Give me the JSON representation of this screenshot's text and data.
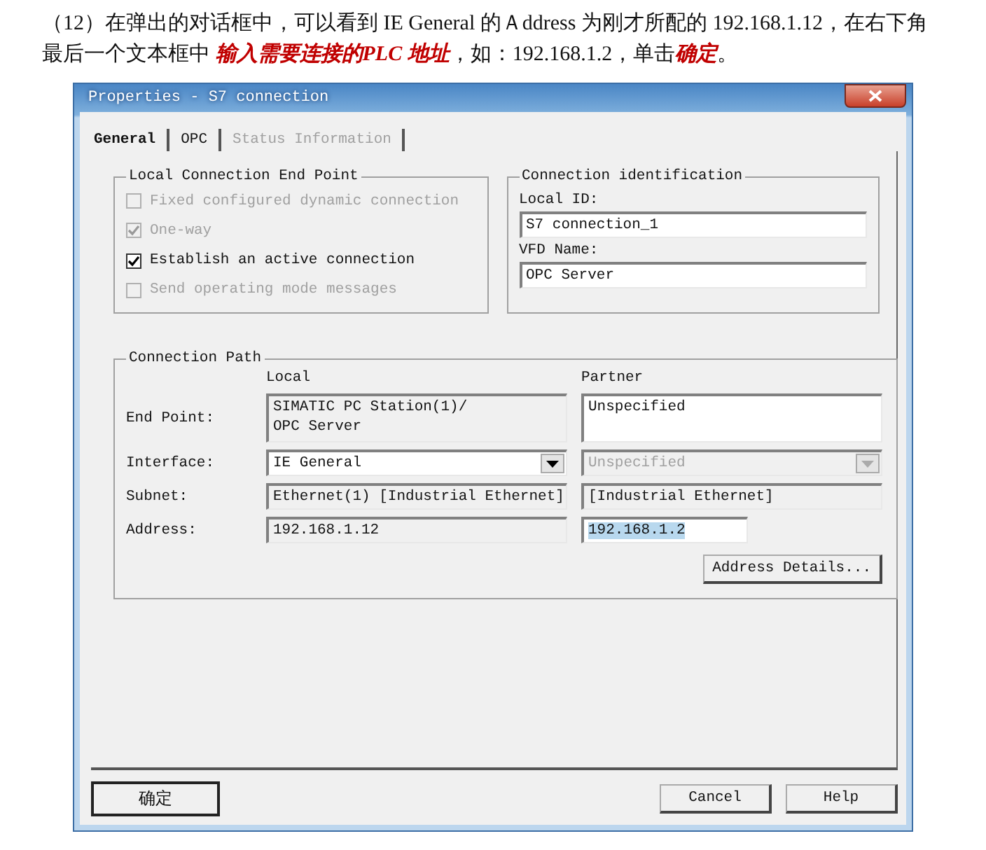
{
  "intro": {
    "text": "（12）在弹出的对话框中，可以看到 IE General 的Ａddress 为刚才所配的 192.168.1.12，在右下角最后一个文本框中 **输入需要连接的PLC 地址**，如：192.168.1.2，单击**确定**。"
  },
  "dialog": {
    "title": "Properties - S7 connection",
    "tabs": [
      {
        "label": "General",
        "selected": true,
        "disabled": false
      },
      {
        "label": "OPC",
        "selected": false,
        "disabled": false
      },
      {
        "label": "Status Information",
        "selected": false,
        "disabled": true
      }
    ],
    "local_end_point": {
      "title": "Local Connection End Point",
      "options": [
        {
          "label": "Fixed configured dynamic connection",
          "checked": false,
          "disabled": true
        },
        {
          "label": "One-way",
          "checked": true,
          "disabled": true
        },
        {
          "label": "Establish an active connection",
          "checked": true,
          "disabled": false
        },
        {
          "label": "Send operating mode messages",
          "checked": false,
          "disabled": true
        }
      ]
    },
    "connection_identification": {
      "title": "Connection identification",
      "local_id_label": "Local ID:",
      "local_id": "S7 connection_1",
      "vfd_name_label": "VFD Name:",
      "vfd_name": "OPC Server"
    },
    "connection_path": {
      "title": "Connection Path",
      "local_heading": "Local",
      "partner_heading": "Partner",
      "rows": [
        {
          "label": "End Point:",
          "kind": "area",
          "local": {
            "value": "SIMATIC PC Station(1)/\nOPC Server",
            "disabled": true
          },
          "partner": {
            "value": "Unspecified",
            "disabled": false
          }
        },
        {
          "label": "Interface:",
          "kind": "dropdown",
          "local": {
            "value": "IE General",
            "disabled": false
          },
          "partner": {
            "value": "Unspecified",
            "disabled": true
          }
        },
        {
          "label": "Subnet:",
          "kind": "static",
          "local": {
            "value": "Ethernet(1) [Industrial Ethernet]",
            "disabled": true
          },
          "partner": {
            "value": "[Industrial Ethernet]",
            "disabled": true
          }
        },
        {
          "label": "Address:",
          "kind": "field",
          "local": {
            "value": "192.168.1.12",
            "disabled": true
          },
          "partner": {
            "value": "192.168.1.2",
            "disabled": false,
            "selected": true
          }
        }
      ],
      "details_button": "Address Details..."
    },
    "buttons": [
      {
        "label": "确定",
        "kind": "default"
      },
      {
        "label": "Cancel",
        "kind": "normal"
      },
      {
        "label": "Help",
        "kind": "normal"
      }
    ]
  }
}
